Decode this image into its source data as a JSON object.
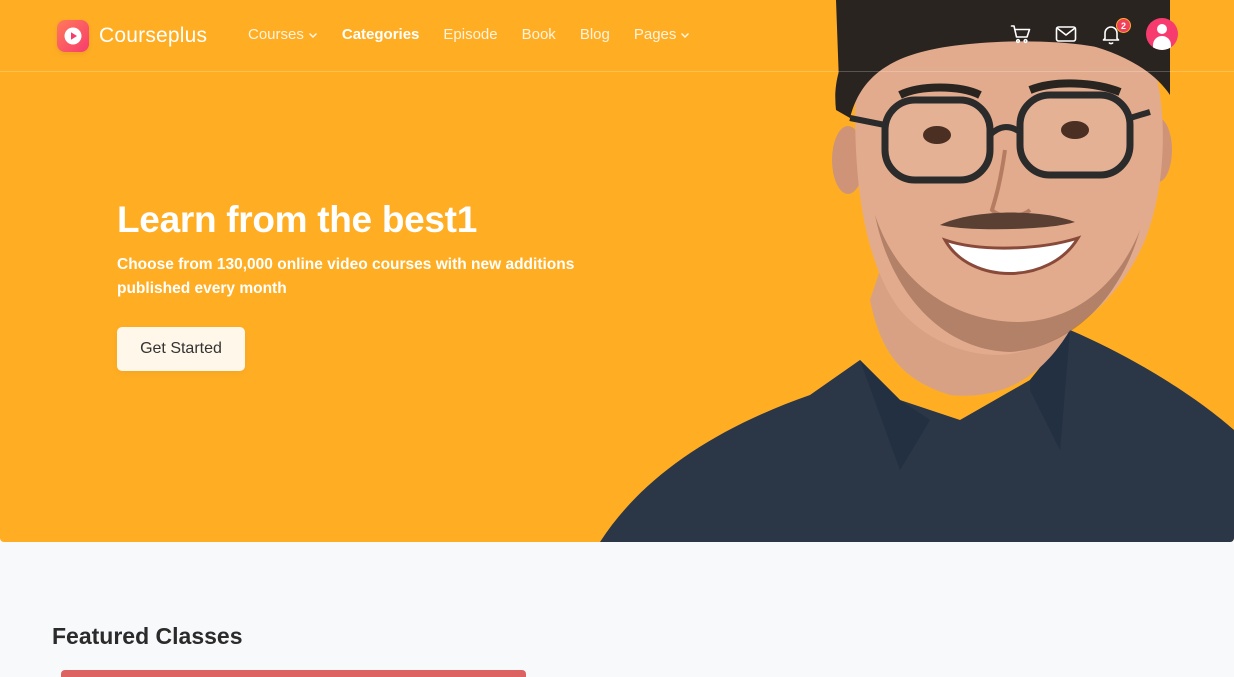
{
  "brand": {
    "name": "Courseplus"
  },
  "nav": {
    "items": [
      {
        "label": "Courses",
        "dropdown": true,
        "active": false
      },
      {
        "label": "Categories",
        "dropdown": false,
        "active": true
      },
      {
        "label": "Episode",
        "dropdown": false,
        "active": false
      },
      {
        "label": "Book",
        "dropdown": false,
        "active": false
      },
      {
        "label": "Blog",
        "dropdown": false,
        "active": false
      },
      {
        "label": "Pages",
        "dropdown": true,
        "active": false
      }
    ]
  },
  "toolbar": {
    "icons": [
      "cart-icon",
      "mail-icon",
      "bell-icon",
      "user-avatar"
    ],
    "notification_count": "2"
  },
  "hero": {
    "title": "Learn from the best1",
    "subtitle": "Choose from 130,000 online video courses with new additions published every month",
    "cta_label": "Get Started"
  },
  "featured": {
    "title": "Featured Classes"
  },
  "colors": {
    "hero_bg": "#ffae24",
    "brand_accent": "#f73b6f",
    "badge": "#f0405c",
    "card_accent": "#dd6262"
  }
}
